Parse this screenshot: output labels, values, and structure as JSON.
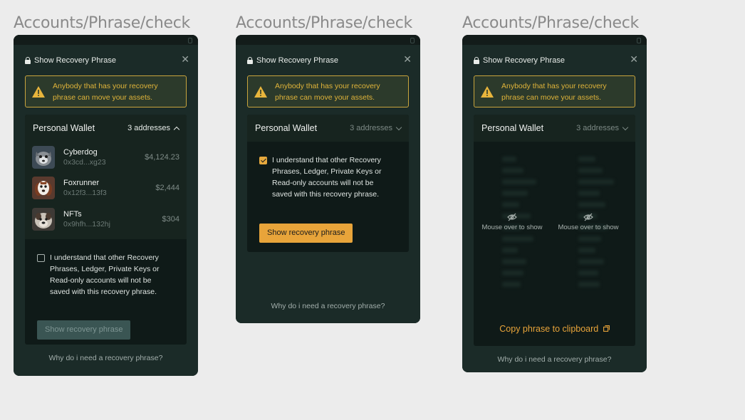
{
  "frame_label": "Accounts/Phrase/check",
  "modal": {
    "title": "Show Recovery Phrase",
    "warning": "Anybody that has your recovery phrase can move your assets.",
    "wallet_name": "Personal Wallet",
    "addresses": "3 addresses",
    "accounts": [
      {
        "name": "Cyberdog",
        "address": "0x3cd...xg23",
        "value": "$4,124.23"
      },
      {
        "name": "Foxrunner",
        "address": "0x12f3...13f3",
        "value": "$2,444"
      },
      {
        "name": "NFTs",
        "address": "0x9hfh...132hj",
        "value": "$304"
      }
    ],
    "consent": "I understand that other Recovery Phrases, Ledger, Private Keys or Read-only accounts will not be saved with this recovery phrase.",
    "show_button": "Show recovery phrase",
    "why_link": "Why do i need a recovery phrase?",
    "mouse_over": "Mouse over to show",
    "copy_link": "Copy phrase to clipboard"
  },
  "colors": {
    "accent": "#e8a43a",
    "warning": "#e0b43a",
    "panel": "#1b2b28"
  }
}
